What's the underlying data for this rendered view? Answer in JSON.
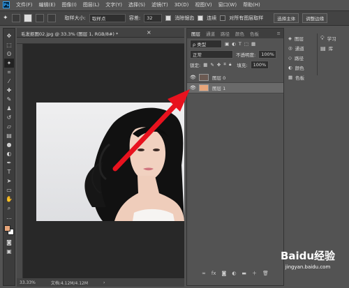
{
  "app": {
    "logo": "Ps"
  },
  "menu": [
    "文件(F)",
    "编辑(E)",
    "图像(I)",
    "图层(L)",
    "文字(Y)",
    "选择(S)",
    "滤镜(T)",
    "3D(D)",
    "视图(V)",
    "窗口(W)",
    "帮助(H)"
  ],
  "options": {
    "sample_size_label": "取样大小:",
    "sample_size_value": "取样点",
    "tolerance_label": "容差:",
    "tolerance_value": "32",
    "antialias_label": "消除锯齿",
    "contiguous_label": "连续",
    "sample_all_label": "对所有图层取样",
    "select_mask_label": "选择主体",
    "refine_label": "调整边缘"
  },
  "document": {
    "tab_title": "毛发抠图02.jpg @ 33.3% (图层 1, RGB/8#) *",
    "zoom": "33.33%",
    "doc_info": "文档:4.12M/4.12M"
  },
  "layers_panel": {
    "tabs": [
      "图层",
      "通道",
      "路径",
      "颜色",
      "色板"
    ],
    "filter_type": "ρ 类型",
    "blend_mode": "正常",
    "opacity_label": "不透明度:",
    "opacity_value": "100%",
    "lock_label": "锁定:",
    "fill_label": "填充:",
    "fill_value": "100%",
    "layers": [
      {
        "name": "图层 0",
        "thumb_color": "#6b5a52",
        "selected": false
      },
      {
        "name": "图层 1",
        "thumb_color": "#e6a57a",
        "selected": true
      }
    ]
  },
  "mini_panels": [
    {
      "label": "图层",
      "icon": "layers-icon"
    },
    {
      "label": "通道",
      "icon": "channels-icon"
    },
    {
      "label": "路径",
      "icon": "paths-icon"
    },
    {
      "label": "颜色",
      "icon": "color-icon"
    },
    {
      "label": "色板",
      "icon": "swatches-icon"
    }
  ],
  "right_panels": [
    {
      "label": "学习",
      "icon": "learn-icon"
    },
    {
      "label": "库",
      "icon": "library-icon"
    }
  ],
  "colors": {
    "foreground": "#e6a57a",
    "background": "#ffffff",
    "arrow": "#e8121e"
  },
  "watermark": {
    "brand": "Baidu经验",
    "url": "jingyan.baidu.com"
  }
}
